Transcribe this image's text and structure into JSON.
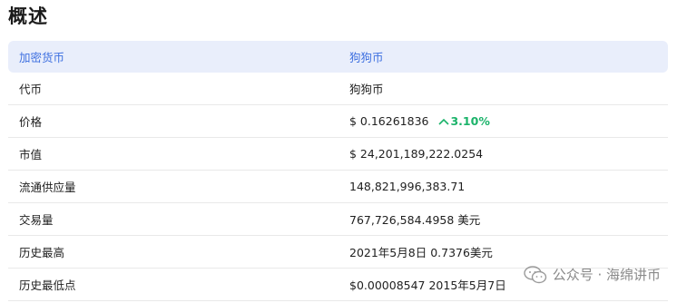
{
  "page": {
    "title": "概述"
  },
  "table": {
    "header": {
      "label": "加密货币",
      "value": "狗狗币"
    },
    "rows": [
      {
        "label": "代币",
        "value": "狗狗币"
      },
      {
        "label": "价格",
        "value": "$ 0.16261836",
        "change": "3.10%",
        "change_direction": "up"
      },
      {
        "label": "市值",
        "value": "$ 24,201,189,222.0254"
      },
      {
        "label": "流通供应量",
        "value": "148,821,996,383.71"
      },
      {
        "label": "交易量",
        "value": "767,726,584.4958 美元"
      },
      {
        "label": "历史最高",
        "value": "2021年5月8日 0.7376美元"
      },
      {
        "label": "历史最低点",
        "value": "$0.00008547 2015年5月7日"
      }
    ]
  },
  "watermark": {
    "text": "公众号 · 海绵讲币",
    "icon": "wechat-icon"
  },
  "colors": {
    "header_bg": "#e9eefb",
    "header_text": "#3d6fe0",
    "positive": "#1bb36a"
  }
}
